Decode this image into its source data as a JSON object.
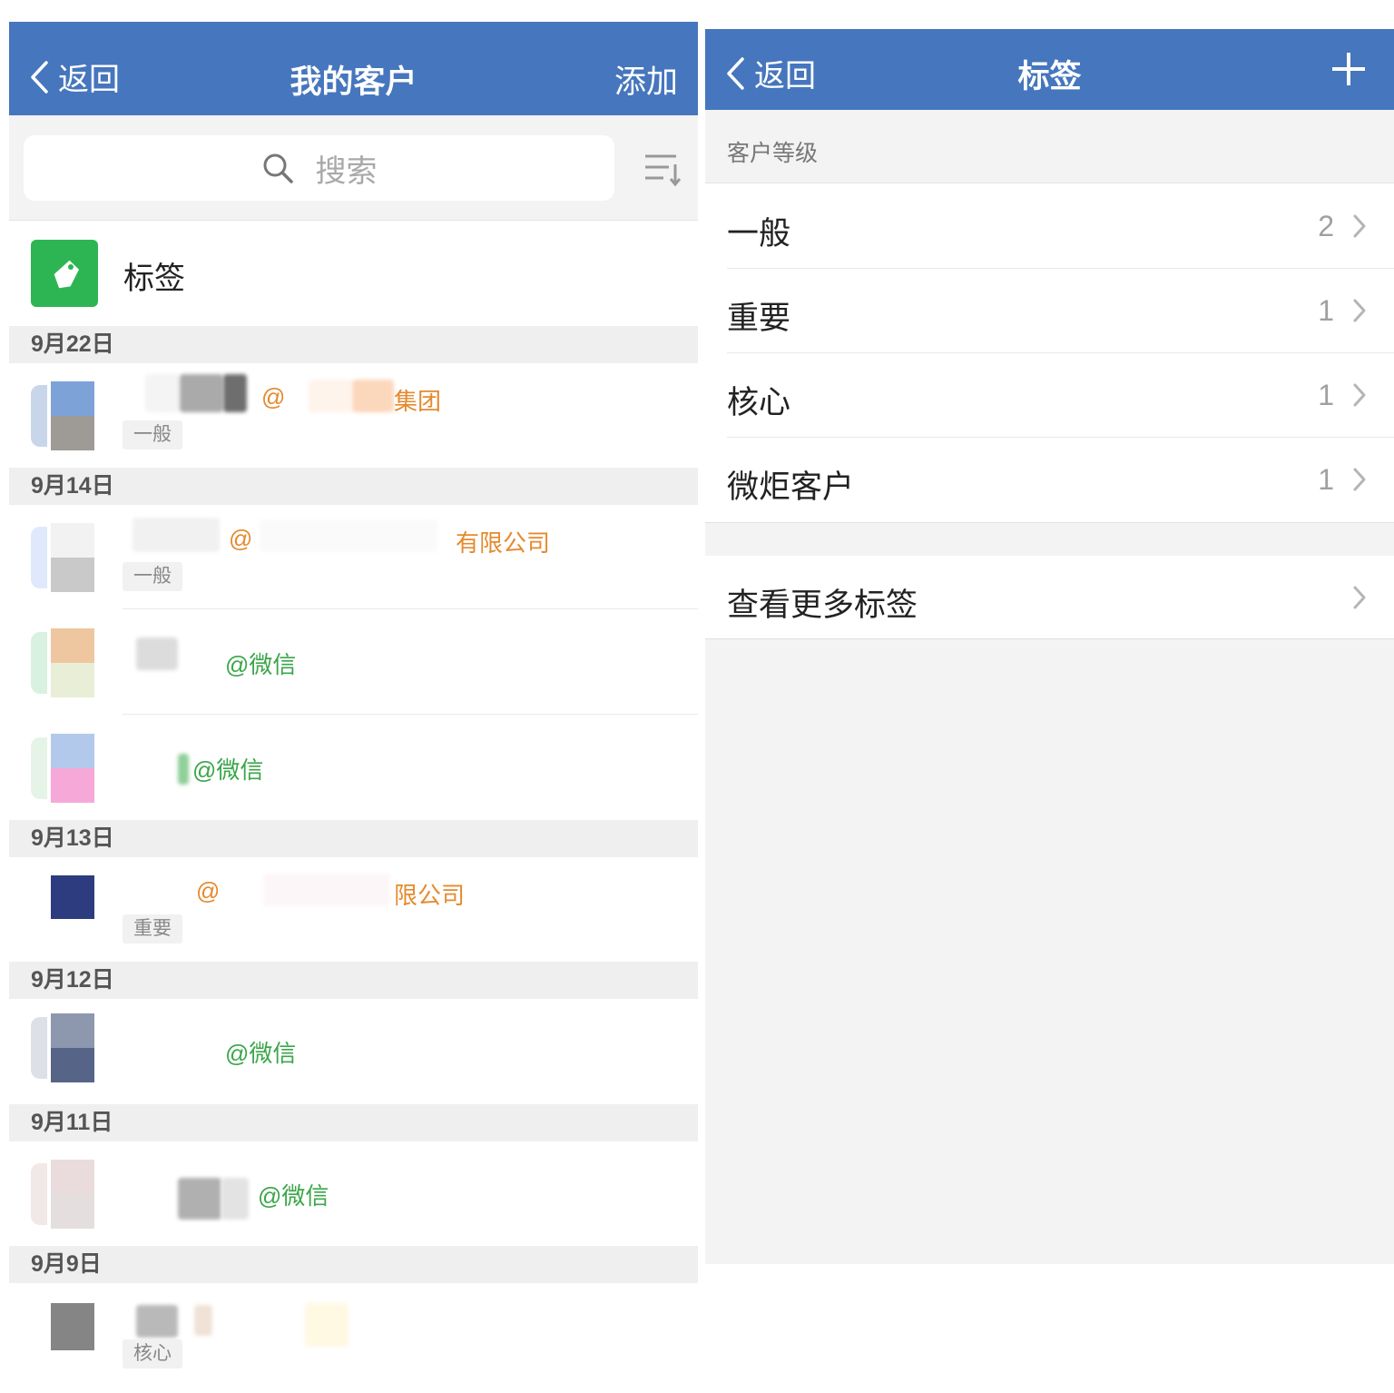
{
  "left_screen": {
    "nav": {
      "back_label": "返回",
      "title": "我的客户",
      "action_label": "添加"
    },
    "search": {
      "placeholder": "搜索"
    },
    "tag_entry": {
      "label": "标签"
    },
    "date_groups": [
      {
        "date": "9月22日",
        "contacts": [
          {
            "suffix": "集团",
            "badge": "一般"
          }
        ]
      },
      {
        "date": "9月14日",
        "contacts": [
          {
            "suffix": "有限公司",
            "badge": "一般"
          },
          {
            "suffix": "@微信"
          },
          {
            "suffix": "@微信"
          }
        ]
      },
      {
        "date": "9月13日",
        "contacts": [
          {
            "suffix": "限公司",
            "badge": "重要"
          }
        ]
      },
      {
        "date": "9月12日",
        "contacts": [
          {
            "suffix": "@微信"
          }
        ]
      },
      {
        "date": "9月11日",
        "contacts": [
          {
            "suffix": "@微信"
          }
        ]
      },
      {
        "date": "9月9日",
        "contacts": [
          {
            "badge": "核心"
          }
        ]
      }
    ]
  },
  "right_screen": {
    "nav": {
      "back_label": "返回",
      "title": "标签"
    },
    "section_title": "客户等级",
    "tags": [
      {
        "name": "一般",
        "count": "2"
      },
      {
        "name": "重要",
        "count": "1"
      },
      {
        "name": "核心",
        "count": "1"
      },
      {
        "name": "微炬客户",
        "count": "1"
      }
    ],
    "more_label": "查看更多标签"
  },
  "colors": {
    "nav_blue": "#4676bd",
    "tag_icon_green": "#2db553",
    "wechat_green": "#3ba64a",
    "company_orange": "#e58a2e"
  },
  "icons": [
    "chevron-left-icon",
    "search-icon",
    "sort-icon",
    "tag-icon",
    "plus-icon",
    "chevron-right-icon"
  ]
}
